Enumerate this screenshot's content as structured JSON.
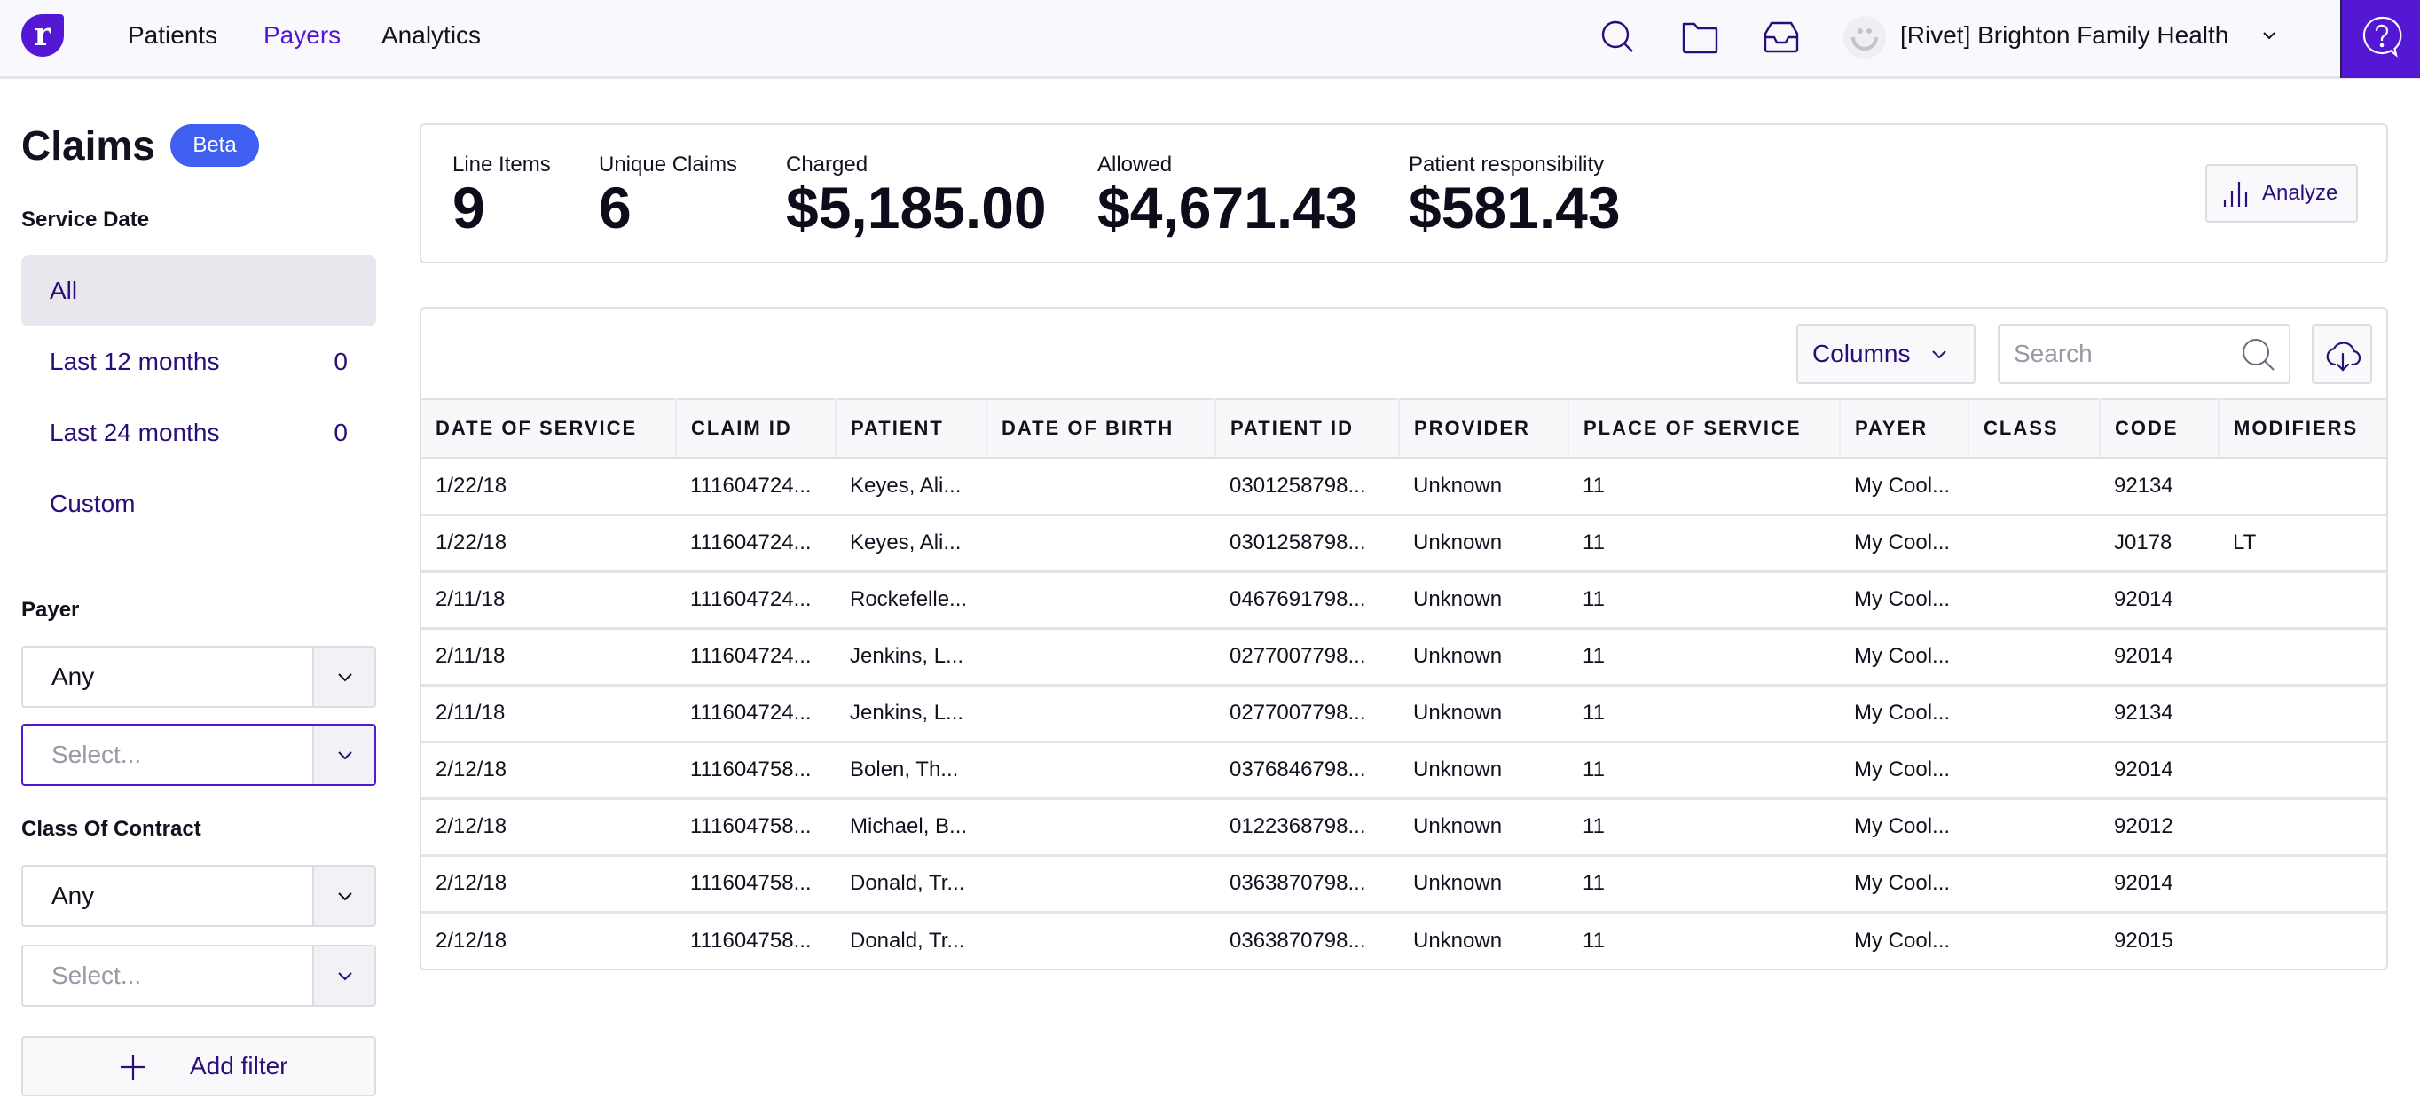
{
  "nav": {
    "logo_letter": "r",
    "links": [
      {
        "label": "Patients",
        "active": false
      },
      {
        "label": "Payers",
        "active": true
      },
      {
        "label": "Analytics",
        "active": false
      }
    ],
    "icons": [
      "search-icon",
      "folder-icon",
      "inbox-icon"
    ],
    "org_name": "[Rivet] Brighton Family Health",
    "accent_color": "#5418d4"
  },
  "sidebar": {
    "title": "Claims",
    "badge": "Beta",
    "service_date": {
      "label": "Service Date",
      "items": [
        {
          "label": "All",
          "count": "",
          "selected": true
        },
        {
          "label": "Last 12 months",
          "count": "0",
          "selected": false
        },
        {
          "label": "Last 24 months",
          "count": "0",
          "selected": false
        },
        {
          "label": "Custom",
          "count": "",
          "selected": false
        }
      ]
    },
    "payer": {
      "label": "Payer",
      "operator_value": "Any",
      "select_placeholder": "Select..."
    },
    "class_of_contract": {
      "label": "Class Of Contract",
      "operator_value": "Any",
      "select_placeholder": "Select..."
    },
    "add_filter_label": "Add filter"
  },
  "stats": {
    "items": [
      {
        "label": "Line Items",
        "value": "9"
      },
      {
        "label": "Unique Claims",
        "value": "6"
      },
      {
        "label": "Charged",
        "value": "$5,185.00"
      },
      {
        "label": "Allowed",
        "value": "$4,671.43"
      },
      {
        "label": "Patient responsibility",
        "value": "$581.43"
      }
    ],
    "analyze_label": "Analyze"
  },
  "table": {
    "columns_button": "Columns",
    "search_placeholder": "Search",
    "search_value": "",
    "headers": [
      "DATE OF SERVICE",
      "CLAIM ID",
      "PATIENT",
      "DATE OF BIRTH",
      "PATIENT ID",
      "PROVIDER",
      "PLACE OF SERVICE",
      "PAYER",
      "CLASS",
      "CODE",
      "MODIFIERS"
    ],
    "rows": [
      [
        "1/22/18",
        "111604724...",
        "Keyes, Ali...",
        "",
        "0301258798...",
        "Unknown",
        "11",
        "My Cool...",
        "",
        "92134",
        ""
      ],
      [
        "1/22/18",
        "111604724...",
        "Keyes, Ali...",
        "",
        "0301258798...",
        "Unknown",
        "11",
        "My Cool...",
        "",
        "J0178",
        "LT"
      ],
      [
        "2/11/18",
        "111604724...",
        "Rockefelle...",
        "",
        "0467691798...",
        "Unknown",
        "11",
        "My Cool...",
        "",
        "92014",
        ""
      ],
      [
        "2/11/18",
        "111604724...",
        "Jenkins, L...",
        "",
        "0277007798...",
        "Unknown",
        "11",
        "My Cool...",
        "",
        "92014",
        ""
      ],
      [
        "2/11/18",
        "111604724...",
        "Jenkins, L...",
        "",
        "0277007798...",
        "Unknown",
        "11",
        "My Cool...",
        "",
        "92134",
        ""
      ],
      [
        "2/12/18",
        "111604758...",
        "Bolen, Th...",
        "",
        "0376846798...",
        "Unknown",
        "11",
        "My Cool...",
        "",
        "92014",
        ""
      ],
      [
        "2/12/18",
        "111604758...",
        "Michael, B...",
        "",
        "0122368798...",
        "Unknown",
        "11",
        "My Cool...",
        "",
        "92012",
        ""
      ],
      [
        "2/12/18",
        "111604758...",
        "Donald, Tr...",
        "",
        "0363870798...",
        "Unknown",
        "11",
        "My Cool...",
        "",
        "92014",
        ""
      ],
      [
        "2/12/18",
        "111604758...",
        "Donald, Tr...",
        "",
        "0363870798...",
        "Unknown",
        "11",
        "My Cool...",
        "",
        "92015",
        ""
      ]
    ]
  }
}
